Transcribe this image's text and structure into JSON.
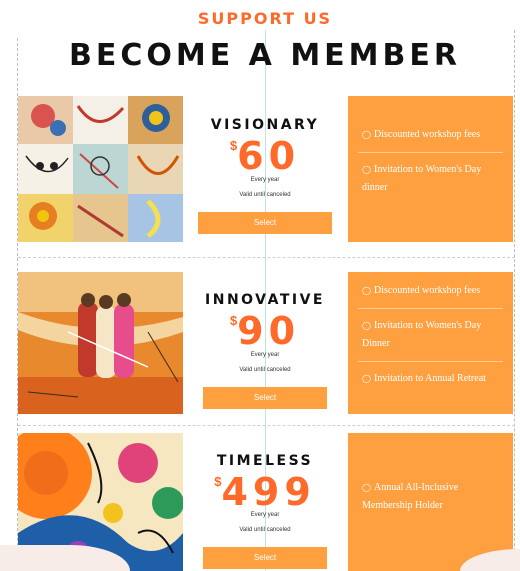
{
  "header": {
    "eyebrow": "SUPPORT US",
    "title": "BECOME A MEMBER"
  },
  "plans": [
    {
      "name": "VISIONARY",
      "currency": "$",
      "amount": "60",
      "period": "Every year",
      "validity": "Valid until canceled",
      "button": "Select",
      "features": [
        "Discounted workshop fees",
        "Invitation to Women's Day dinner"
      ]
    },
    {
      "name": "INNOVATIVE",
      "currency": "$",
      "amount": "90",
      "period": "Every year",
      "validity": "Valid until canceled",
      "button": "Select",
      "features": [
        "Discounted workshop fees",
        "Invitation to Women's Day Dinner",
        "Invitation to Annual Retreat"
      ]
    },
    {
      "name": "TIMELESS",
      "currency": "$",
      "amount": "499",
      "period": "Every year",
      "validity": "Valid until canceled",
      "button": "Select",
      "features": [
        "Annual All-Inclusive Membership Holder"
      ]
    }
  ],
  "icons": {
    "feature_bullet": "check-circle-icon"
  },
  "colors": {
    "accent": "#ff6a2b",
    "panel": "#ffa040",
    "title": "#111111"
  }
}
